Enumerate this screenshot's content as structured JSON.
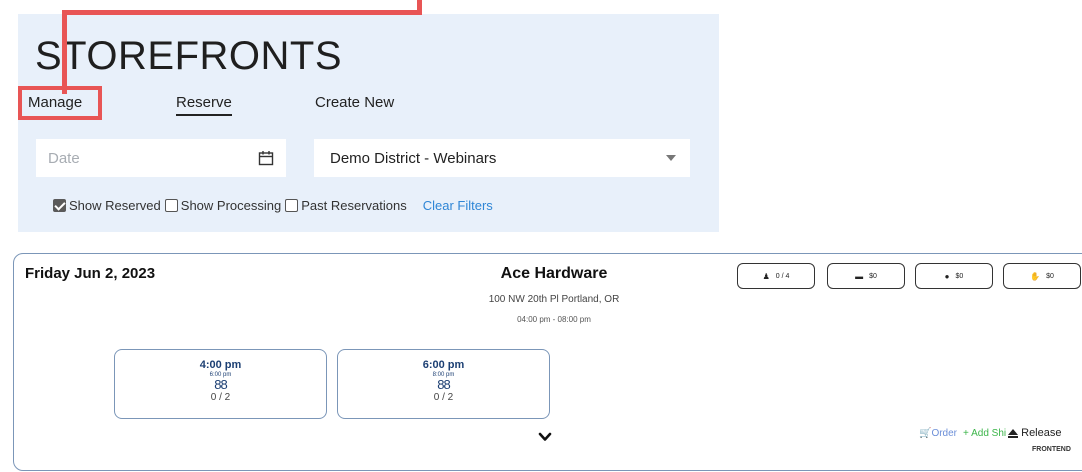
{
  "header": {
    "title": "STOREFRONTS",
    "tabs": [
      {
        "label": "Manage"
      },
      {
        "label": "Reserve"
      },
      {
        "label": "Create New"
      }
    ]
  },
  "filters": {
    "date_placeholder": "Date",
    "district_selected": "Demo District - Webinars",
    "checkboxes": [
      {
        "label": "Show Reserved",
        "checked": true
      },
      {
        "label": "Show Processing",
        "checked": false
      },
      {
        "label": "Past Reservations",
        "checked": false
      }
    ],
    "clear_label": "Clear Filters"
  },
  "reservation": {
    "date": "Friday Jun 2, 2023",
    "store_name": "Ace Hardware",
    "address": "100 NW 20th Pl Portland, OR",
    "hours": "04:00 pm - 08:00 pm",
    "stats": [
      {
        "icon": "person-icon",
        "value": "0 / 4"
      },
      {
        "icon": "cash-icon",
        "value": "$0"
      },
      {
        "icon": "bag-icon",
        "value": "$0"
      },
      {
        "icon": "hand-money-icon",
        "value": "$0"
      }
    ],
    "slots": [
      {
        "start": "4:00 pm",
        "end": "6:00 pm",
        "people_icon": "88",
        "count": "0 / 2"
      },
      {
        "start": "6:00 pm",
        "end": "8:00 pm",
        "people_icon": "88",
        "count": "0 / 2"
      }
    ],
    "actions": {
      "order": "Order",
      "add": "Add Shi",
      "release": "Release"
    },
    "brand_text": "FRONTEND"
  },
  "colors": {
    "panel_bg": "#e8f0fa",
    "annotation_red": "#e85555",
    "link_blue": "#2f86d6",
    "slot_text": "#1c3f73",
    "add_green": "#3cb54a"
  }
}
